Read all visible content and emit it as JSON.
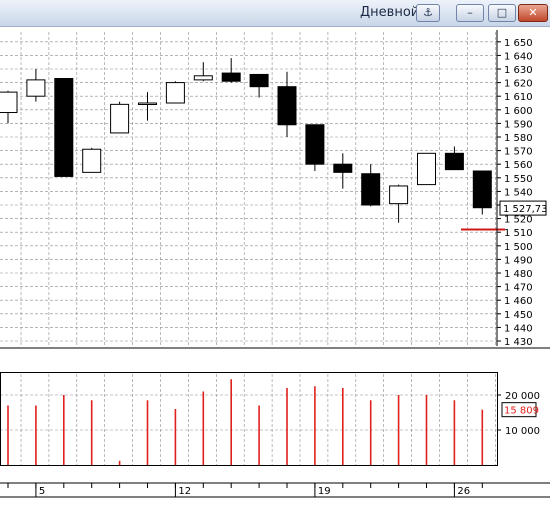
{
  "window": {
    "title": "Дневной",
    "anchor_icon": "⚓",
    "minimize_icon": "–",
    "maximize_icon": "□",
    "close_icon": "✕"
  },
  "colors": {
    "up_candle_fill": "#ffffff",
    "down_candle_fill": "#000000",
    "volume_bar": "#e0201c",
    "price_marker": "#d01818",
    "grid": "#8c8c8c"
  },
  "chart_data": [
    {
      "type": "candlestick",
      "title": "",
      "y_ticks": [
        "1 650",
        "1 640",
        "1 630",
        "1 620",
        "1 610",
        "1 600",
        "1 590",
        "1 580",
        "1 570",
        "1 560",
        "1 550",
        "1 540",
        "1 530",
        "1 520",
        "1 510",
        "1 500",
        "1 490",
        "1 480",
        "1 470",
        "1 460",
        "1 450",
        "1 440",
        "1 430"
      ],
      "ylim": [
        1427,
        1654
      ],
      "grid": true,
      "current_price_label": "1 527,73",
      "current_price": 1527.73,
      "price_line": 1512,
      "candles": [
        {
          "open": 1598,
          "high": 1614,
          "low": 1590,
          "close": 1613
        },
        {
          "open": 1610,
          "high": 1630,
          "low": 1606,
          "close": 1622
        },
        {
          "open": 1623,
          "high": 1623,
          "low": 1551,
          "close": 1551
        },
        {
          "open": 1554,
          "high": 1572,
          "low": 1554,
          "close": 1571
        },
        {
          "open": 1583,
          "high": 1606,
          "low": 1583,
          "close": 1604
        },
        {
          "open": 1604,
          "high": 1613,
          "low": 1592,
          "close": 1605
        },
        {
          "open": 1605,
          "high": 1621,
          "low": 1605,
          "close": 1620
        },
        {
          "open": 1622,
          "high": 1635,
          "low": 1621,
          "close": 1625
        },
        {
          "open": 1627,
          "high": 1638,
          "low": 1620,
          "close": 1621
        },
        {
          "open": 1626,
          "high": 1626,
          "low": 1609,
          "close": 1617
        },
        {
          "open": 1617,
          "high": 1628,
          "low": 1580,
          "close": 1589
        },
        {
          "open": 1589,
          "high": 1589,
          "low": 1555,
          "close": 1560
        },
        {
          "open": 1560,
          "high": 1568,
          "low": 1542,
          "close": 1554
        },
        {
          "open": 1553,
          "high": 1560,
          "low": 1529,
          "close": 1530
        },
        {
          "open": 1531,
          "high": 1545,
          "low": 1517,
          "close": 1544
        },
        {
          "open": 1545,
          "high": 1568,
          "low": 1545,
          "close": 1568
        },
        {
          "open": 1568,
          "high": 1573,
          "low": 1556,
          "close": 1556
        },
        {
          "open": 1555,
          "high": 1555,
          "low": 1523,
          "close": 1528
        }
      ]
    },
    {
      "type": "bar",
      "title": "",
      "y_ticks": [
        "20 000",
        "10 000"
      ],
      "tick_values": [
        20000,
        10000
      ],
      "ylim": [
        0,
        26000
      ],
      "grid": true,
      "current_value_label": "15 809",
      "current_value": 15809,
      "values": [
        17000,
        17000,
        20000,
        18500,
        1200,
        18500,
        16000,
        21000,
        24500,
        17000,
        22000,
        22500,
        22000,
        18500,
        20000,
        20000,
        18500,
        15809
      ]
    }
  ],
  "x_axis": {
    "ticks": [
      "5",
      "12",
      "19",
      "26"
    ],
    "tick_candle_index": [
      1,
      6,
      11,
      16
    ]
  }
}
